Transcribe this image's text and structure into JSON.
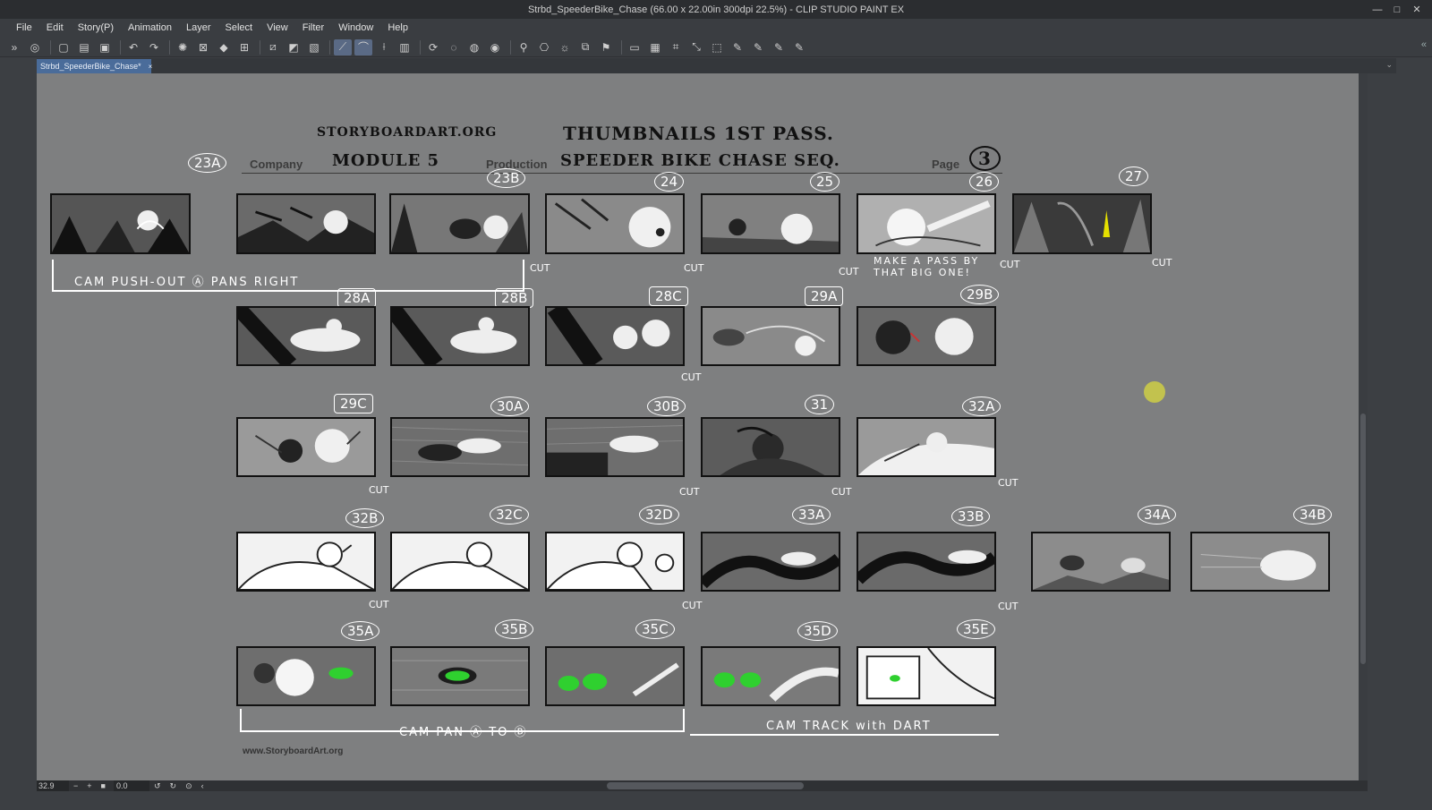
{
  "window": {
    "title": "Strbd_SpeederBike_Chase (66.00 x 22.00in 300dpi 22.5%) - CLIP STUDIO PAINT EX",
    "controls": [
      "—",
      "□",
      "✕"
    ]
  },
  "menu": [
    "File",
    "Edit",
    "Story(P)",
    "Animation",
    "Layer",
    "Select",
    "View",
    "Filter",
    "Window",
    "Help"
  ],
  "tab": {
    "label": "Strbd_SpeederBike_Chase*",
    "close": "×"
  },
  "status": {
    "zoom": "32.9",
    "angle": "0.0"
  },
  "sheet": {
    "site_header": "STORYBOARDART.ORG",
    "title_hand": "THUMBNAILS 1ST PASS.",
    "company_label": "Company",
    "company_value": "MODULE 5",
    "production_label": "Production",
    "production_value": "SPEEDER BIKE CHASE SEQ.",
    "page_label": "Page",
    "page_value": "3",
    "footer": "www.StoryboardArt.org",
    "notes": {
      "row1_bottom": "CAM PUSH-OUT Ⓐ PANS RIGHT",
      "row1_right": "MAKE A PASS BY THAT BIG ONE!",
      "row5_left": "CAM PAN Ⓐ TO Ⓑ",
      "row5_right": "CAM TRACK with DART"
    },
    "cut": "CUT",
    "panels": [
      {
        "id": "23A"
      },
      {
        "id": "23B"
      },
      {
        "id": "24"
      },
      {
        "id": "25"
      },
      {
        "id": "26"
      },
      {
        "id": "27"
      },
      {
        "id": "28A"
      },
      {
        "id": "28B"
      },
      {
        "id": "28C"
      },
      {
        "id": "29A"
      },
      {
        "id": "29B"
      },
      {
        "id": "29C"
      },
      {
        "id": "30A"
      },
      {
        "id": "30B"
      },
      {
        "id": "31"
      },
      {
        "id": "32A"
      },
      {
        "id": "32B"
      },
      {
        "id": "32C"
      },
      {
        "id": "32D"
      },
      {
        "id": "33A"
      },
      {
        "id": "33B"
      },
      {
        "id": "34A"
      },
      {
        "id": "34B"
      },
      {
        "id": "35A"
      },
      {
        "id": "35B"
      },
      {
        "id": "35C"
      },
      {
        "id": "35D"
      },
      {
        "id": "35E"
      }
    ]
  },
  "colors": {
    "canvas": "#7e7f80",
    "panel_ink": "#111111",
    "accent_green": "#2fd02f",
    "accent_yellow": "#e5e000",
    "cursor_dot": "#c2c24e"
  }
}
